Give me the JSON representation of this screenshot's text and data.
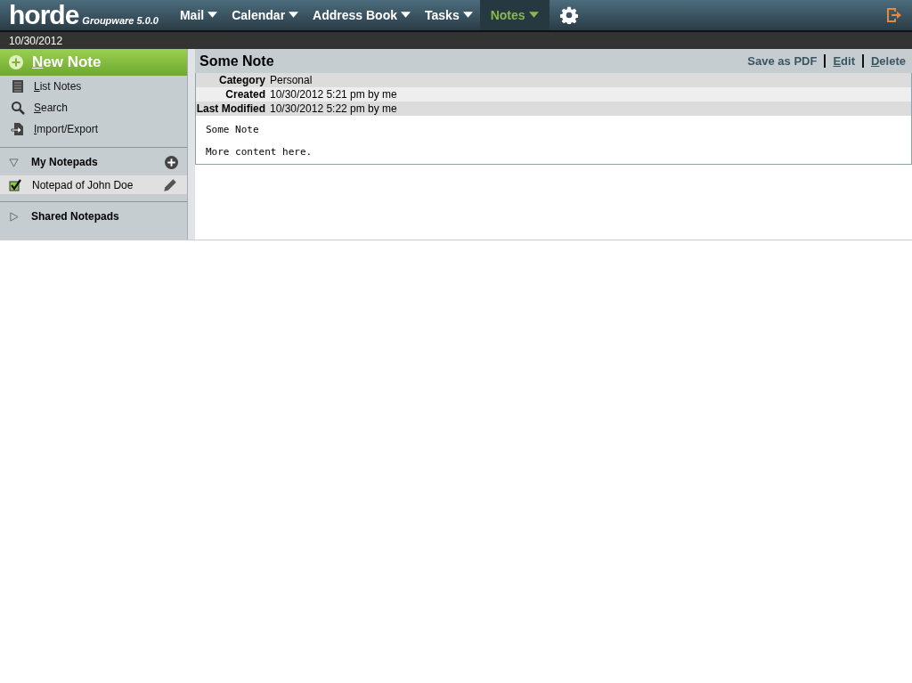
{
  "header": {
    "logo": "horde",
    "version": "Groupware 5.0.0",
    "menu": [
      {
        "label": "Mail",
        "selected": false
      },
      {
        "label": "Calendar",
        "selected": false
      },
      {
        "label": "Address Book",
        "selected": false
      },
      {
        "label": "Tasks",
        "selected": false
      },
      {
        "label": "Notes",
        "selected": true
      }
    ]
  },
  "date_bar": "10/30/2012",
  "sidebar": {
    "new_button": "New Note",
    "links": [
      {
        "label": "List Notes",
        "kind": "list"
      },
      {
        "label": "Search",
        "kind": "search"
      },
      {
        "label": "Import/Export",
        "kind": "import"
      }
    ],
    "sections": [
      {
        "title": "My Notepads",
        "expanded": true,
        "add": true,
        "items": [
          {
            "label": "Notepad of John Doe",
            "checked": true
          }
        ]
      },
      {
        "title": "Shared Notepads",
        "expanded": false,
        "add": false
      }
    ]
  },
  "note": {
    "title": "Some Note",
    "actions": [
      "Save as PDF",
      "Edit",
      "Delete"
    ],
    "fields": [
      {
        "label": "Category",
        "value": "Personal"
      },
      {
        "label": "Created",
        "value": "10/30/2012 5:21 pm by me"
      },
      {
        "label": "Last Modified",
        "value": "10/30/2012 5:22 pm by me"
      }
    ],
    "body": [
      "Some Note",
      "More content here."
    ]
  }
}
